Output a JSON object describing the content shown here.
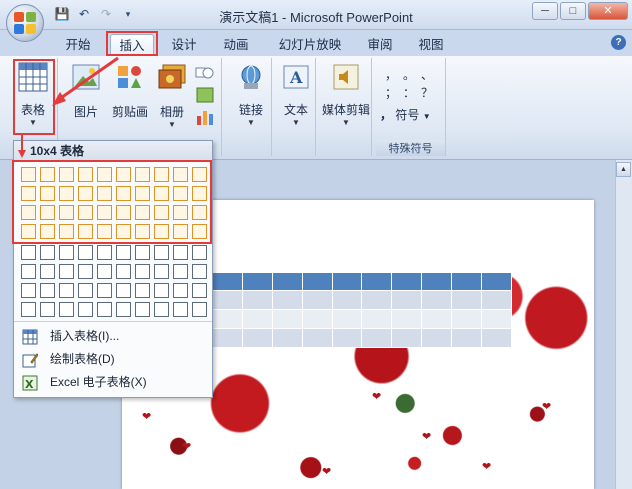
{
  "window": {
    "title": "演示文稿1 - Microsoft PowerPoint",
    "minimize": "─",
    "maximize": "□",
    "close": "✕"
  },
  "tabs": [
    {
      "label": "开始"
    },
    {
      "label": "插入",
      "active": true
    },
    {
      "label": "设计"
    },
    {
      "label": "动画"
    },
    {
      "label": "幻灯片放映"
    },
    {
      "label": "审阅"
    },
    {
      "label": "视图"
    }
  ],
  "help_label": "?",
  "ribbon": {
    "table_label": "表格",
    "picture_label": "图片",
    "clipart_label": "剪贴画",
    "album_label": "相册",
    "link_label": "链接",
    "text_label": "文本",
    "media_label": "媒体剪辑",
    "symbol_label": "符号",
    "special_symbols_group": "特殊符号",
    "symbols": [
      "，",
      "。",
      "、",
      "；",
      "：",
      "？",
      "，"
    ]
  },
  "dropdown": {
    "header": "10x4 表格",
    "grid_cols": 10,
    "grid_rows": 8,
    "selected_cols": 10,
    "selected_rows": 4,
    "items": [
      {
        "label": "插入表格(I)..."
      },
      {
        "label": "绘制表格(D)"
      },
      {
        "label": "Excel 电子表格(X)"
      }
    ]
  },
  "colors": {
    "annotation_red": "#e33a3a",
    "selection_orange": "#e0922a",
    "table_header_blue": "#4f81bd"
  }
}
